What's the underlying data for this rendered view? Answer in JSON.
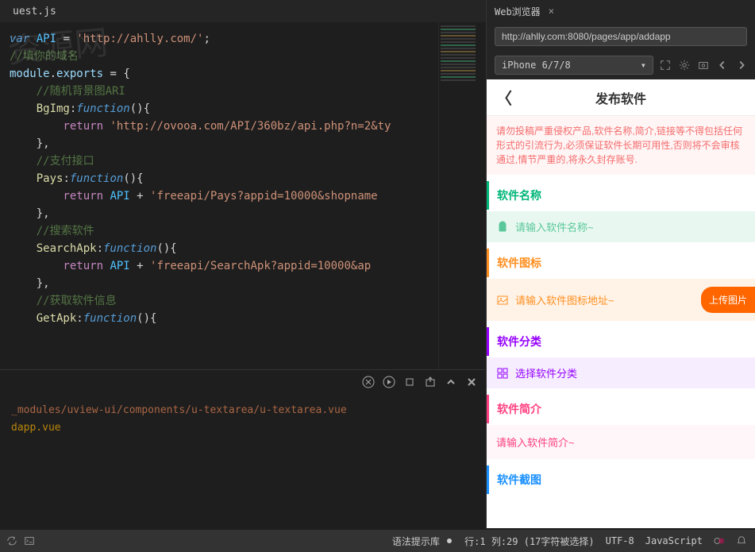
{
  "editor": {
    "tab": "uest.js",
    "code_lines": [
      {
        "segments": [
          {
            "t": "var ",
            "c": "k-var"
          },
          {
            "t": "API",
            "c": "k-const"
          },
          {
            "t": " = ",
            "c": "k-punct"
          },
          {
            "t": "'http://ahlly.com/'",
            "c": "k-str"
          },
          {
            "t": ";",
            "c": "k-punct"
          }
        ]
      },
      {
        "segments": [
          {
            "t": "//填你的域名",
            "c": "k-comment"
          }
        ]
      },
      {
        "segments": [
          {
            "t": "module",
            "c": "k-ident"
          },
          {
            "t": ".",
            "c": "k-punct"
          },
          {
            "t": "exports",
            "c": "k-prop"
          },
          {
            "t": " = {",
            "c": "k-punct"
          }
        ]
      },
      {
        "segments": [
          {
            "t": "    //随机背景图ARI",
            "c": "k-comment"
          }
        ]
      },
      {
        "segments": [
          {
            "t": "    BgImg",
            "c": "k-func"
          },
          {
            "t": ":",
            "c": "k-punct"
          },
          {
            "t": "function",
            "c": "k-fn"
          },
          {
            "t": "(){",
            "c": "k-punct"
          }
        ]
      },
      {
        "segments": [
          {
            "t": "        return ",
            "c": "k-ret"
          },
          {
            "t": "'http://ovooa.com/API/360bz/api.php?n=2&ty",
            "c": "k-str"
          }
        ]
      },
      {
        "segments": [
          {
            "t": "    },",
            "c": "k-punct"
          }
        ]
      },
      {
        "segments": [
          {
            "t": "    //支付接口",
            "c": "k-comment"
          }
        ]
      },
      {
        "segments": [
          {
            "t": "    Pays",
            "c": "k-func"
          },
          {
            "t": ":",
            "c": "k-punct"
          },
          {
            "t": "function",
            "c": "k-fn"
          },
          {
            "t": "(){",
            "c": "k-punct"
          }
        ]
      },
      {
        "segments": [
          {
            "t": "        return ",
            "c": "k-ret"
          },
          {
            "t": "API",
            "c": "k-const"
          },
          {
            "t": " + ",
            "c": "k-punct"
          },
          {
            "t": "'freeapi/Pays?appid=10000&shopname",
            "c": "k-str"
          }
        ]
      },
      {
        "segments": [
          {
            "t": "    },",
            "c": "k-punct"
          }
        ]
      },
      {
        "segments": [
          {
            "t": "    //搜索软件",
            "c": "k-comment"
          }
        ]
      },
      {
        "segments": [
          {
            "t": "    SearchApk",
            "c": "k-func"
          },
          {
            "t": ":",
            "c": "k-punct"
          },
          {
            "t": "function",
            "c": "k-fn"
          },
          {
            "t": "(){",
            "c": "k-punct"
          }
        ]
      },
      {
        "segments": [
          {
            "t": "        return ",
            "c": "k-ret"
          },
          {
            "t": "API",
            "c": "k-const"
          },
          {
            "t": " + ",
            "c": "k-punct"
          },
          {
            "t": "'freeapi/SearchApk?appid=10000&ap",
            "c": "k-str"
          }
        ]
      },
      {
        "segments": [
          {
            "t": "    },",
            "c": "k-punct"
          }
        ]
      },
      {
        "segments": [
          {
            "t": "    //获取软件信息",
            "c": "k-comment"
          }
        ]
      },
      {
        "segments": [
          {
            "t": "    GetApk",
            "c": "k-func"
          },
          {
            "t": ":",
            "c": "k-punct"
          },
          {
            "t": "function",
            "c": "k-fn"
          },
          {
            "t": "(){",
            "c": "k-punct"
          }
        ]
      }
    ]
  },
  "terminal": {
    "path_line": "_modules/uview-ui/components/u-textarea/u-textarea.vue",
    "file_line": "dapp.vue"
  },
  "browser": {
    "tab_label": "Web浏览器",
    "url": "http://ahlly.com:8080/pages/app/addapp",
    "device": "iPhone 6/7/8"
  },
  "preview": {
    "title": "发布软件",
    "notice": "请勿投稿严重侵权产品,软件名称,简介,链接等不得包括任何形式的引流行为,必须保证软件长期可用性,否则将不会审核通过,情节严重的,将永久封存账号.",
    "sections": {
      "name": {
        "title": "软件名称",
        "placeholder": "请输入软件名称~"
      },
      "icon": {
        "title": "软件图标",
        "placeholder": "请输入软件图标地址~",
        "upload": "上传图片"
      },
      "category": {
        "title": "软件分类",
        "placeholder": "选择软件分类"
      },
      "intro": {
        "title": "软件简介",
        "placeholder": "请输入软件简介~"
      },
      "screenshot": {
        "title": "软件截图"
      }
    }
  },
  "status": {
    "hint": "语法提示库",
    "cursor": "行:1 列:29 (17字符被选择)",
    "encoding": "UTF-8",
    "lang": "JavaScript"
  }
}
